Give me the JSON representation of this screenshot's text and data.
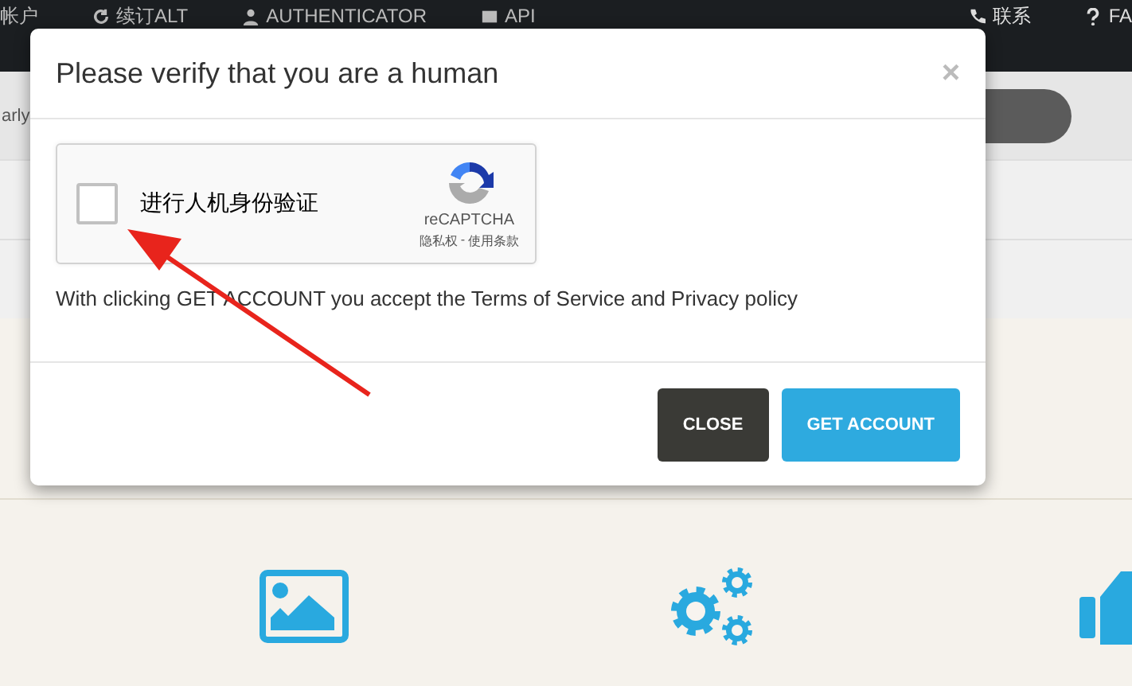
{
  "nav": {
    "items": [
      {
        "label": "帐户",
        "kind": "text"
      },
      {
        "label": "续订ALT",
        "kind": "refresh"
      },
      {
        "label": "AUTHENTICATOR",
        "kind": "person"
      },
      {
        "label": "API",
        "kind": "doc"
      },
      {
        "label": "联系",
        "kind": "phone"
      },
      {
        "label": "FA",
        "kind": "help"
      }
    ]
  },
  "search": {
    "value": "arly"
  },
  "dialog": {
    "title": "Please verify that you are a human",
    "close_symbol": "×",
    "captcha": {
      "checked": false,
      "label": "进行人机身份验证",
      "brand": "reCAPTCHA",
      "privacy": "隐私权",
      "separator": "-",
      "terms": "使用条款"
    },
    "notice": "With clicking GET ACCOUNT you accept the Terms of Service and Privacy policy",
    "buttons": [
      {
        "label": "CLOSE",
        "kind": "secondary"
      },
      {
        "label": "GET ACCOUNT",
        "kind": "primary"
      }
    ]
  },
  "features": [
    {
      "kind": "image"
    },
    {
      "kind": "gears"
    },
    {
      "kind": "thumb"
    }
  ]
}
